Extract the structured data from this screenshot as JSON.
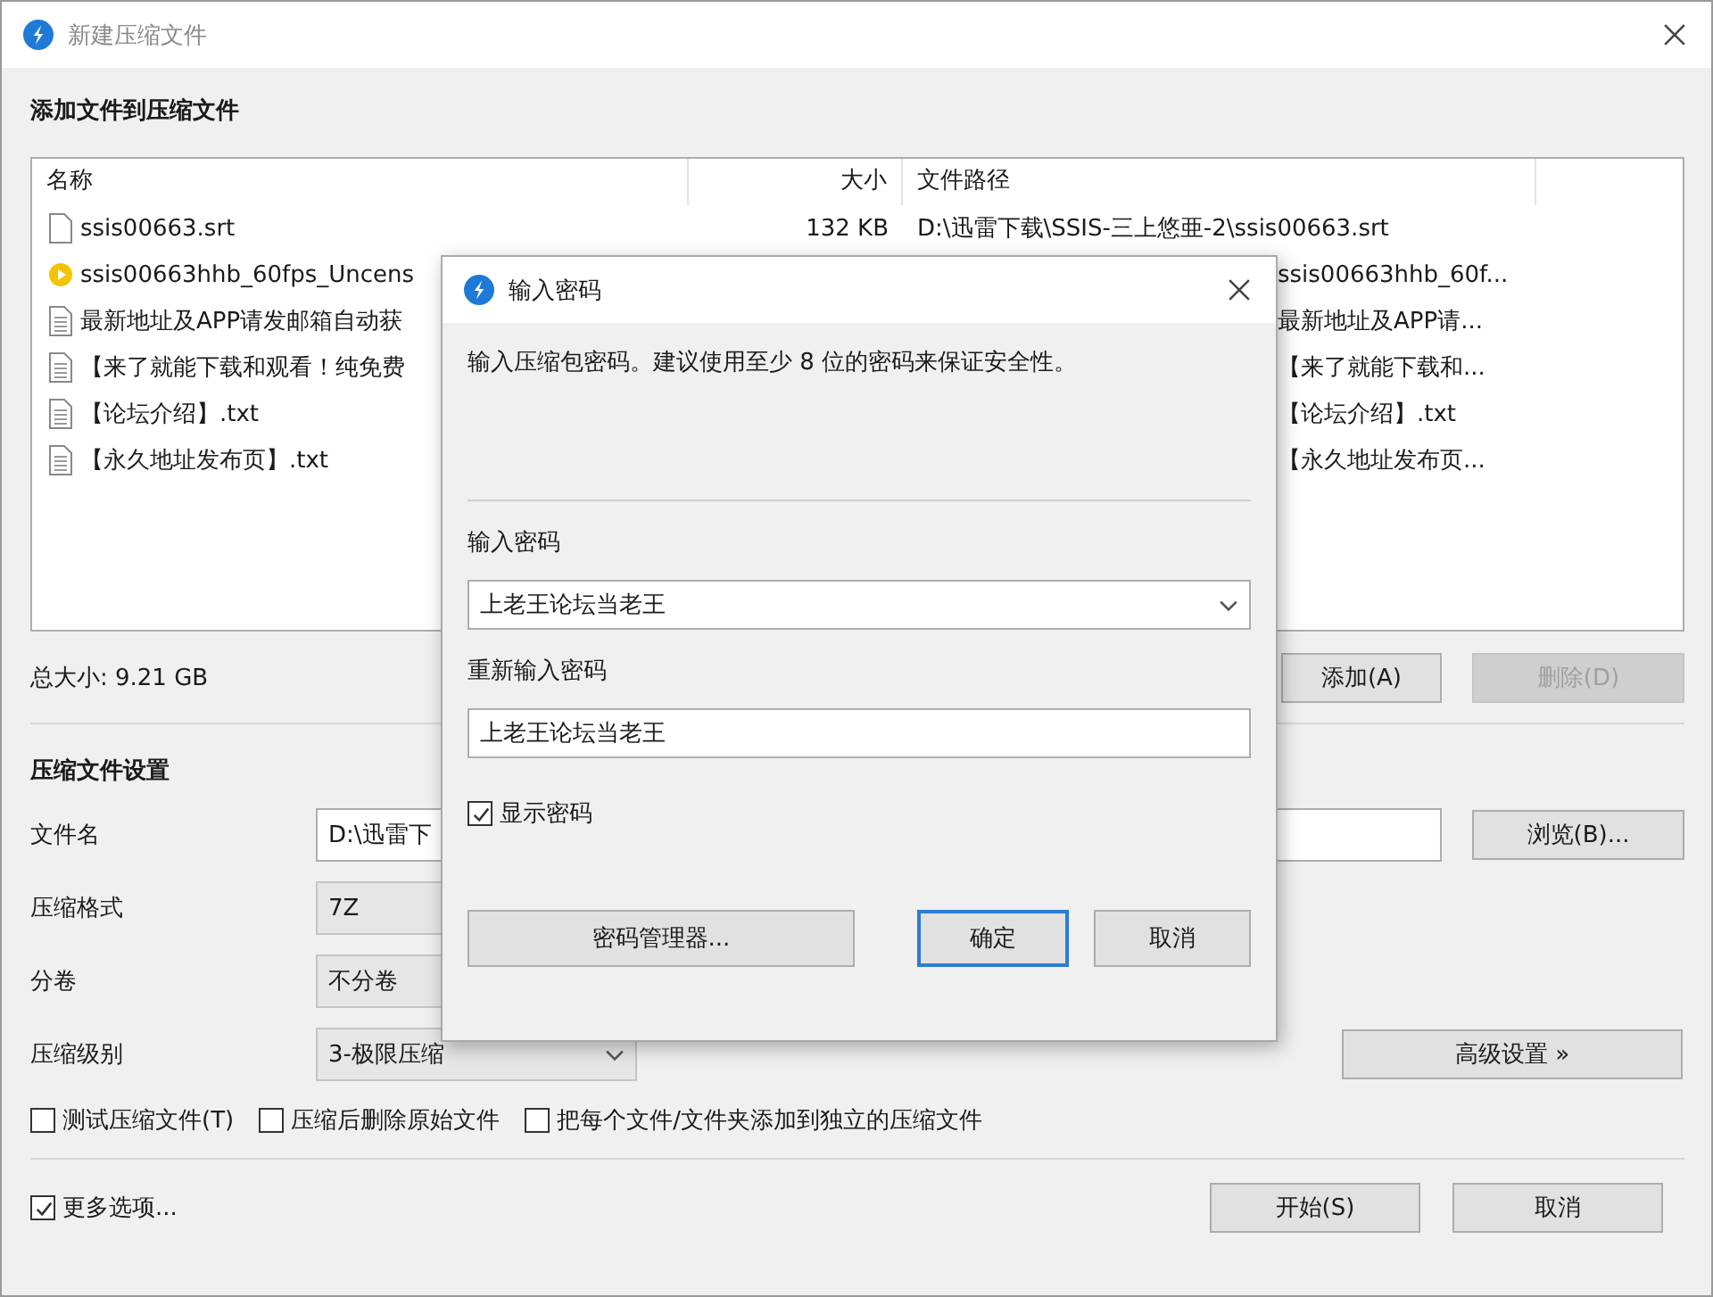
{
  "window": {
    "title": "新建压缩文件"
  },
  "files": {
    "heading": "添加文件到压缩文件",
    "columns": [
      {
        "label": "名称"
      },
      {
        "label": "大小"
      },
      {
        "label": "文件路径"
      }
    ],
    "rows": [
      {
        "kind": "blank",
        "name": "ssis00663.srt",
        "size": "132 KB",
        "path": "D:\\迅雷下载\\SSIS-三上悠亜-2\\ssis00663.srt"
      },
      {
        "kind": "media",
        "name": "ssis00663hhb_60fps_Uncens",
        "path": "ssis00663hhb_60f..."
      },
      {
        "kind": "text",
        "name": "最新地址及APP请发邮箱自动获",
        "path": "最新地址及APP请..."
      },
      {
        "kind": "text",
        "name": "【来了就能下载和观看！纯免费",
        "path": "【来了就能下载和..."
      },
      {
        "kind": "text",
        "name": "【论坛介绍】.txt",
        "path": "【论坛介绍】.txt"
      },
      {
        "kind": "text",
        "name": "【永久地址发布页】.txt",
        "path": "【永久地址发布页..."
      }
    ]
  },
  "total_size": "总大小: 9.21 GB",
  "list_buttons": [
    {
      "label": "添加(A)",
      "disabled": false
    },
    {
      "label": "删除(D)",
      "disabled": true
    }
  ],
  "settings": {
    "heading": "压缩文件设置",
    "fields": [
      {
        "kind": "text",
        "label": "文件名",
        "value": "D:\\迅雷下"
      },
      {
        "kind": "combo",
        "label": "压缩格式",
        "value": "7Z"
      },
      {
        "kind": "combo",
        "label": "分卷",
        "value": "不分卷"
      },
      {
        "kind": "combo",
        "label": "压缩级别",
        "value": "3-极限压缩"
      }
    ],
    "browse_button": "浏览(B)...",
    "advanced_button": "高级设置 »"
  },
  "options": [
    {
      "label": "测试压缩文件(T)",
      "checked": false
    },
    {
      "label": "压缩后删除原始文件",
      "checked": false
    },
    {
      "label": "把每个文件/文件夹添加到独立的压缩文件",
      "checked": false
    }
  ],
  "more_options": {
    "label": "更多选项...",
    "checked": true
  },
  "footer_buttons": [
    {
      "label": "开始(S)"
    },
    {
      "label": "取消"
    }
  ],
  "dialog": {
    "title": "输入密码",
    "description": "输入压缩包密码。建议使用至少 8 位的密码来保证安全性。",
    "password_label": "输入密码",
    "password": "上老王论坛当老王",
    "confirm_label": "重新输入密码",
    "confirm": "上老王论坛当老王",
    "show_password": {
      "label": "显示密码",
      "checked": true
    },
    "buttons": [
      {
        "label": "密码管理器...",
        "default": false
      },
      {
        "label": "确定",
        "default": true
      },
      {
        "label": "取消",
        "default": false
      }
    ]
  }
}
